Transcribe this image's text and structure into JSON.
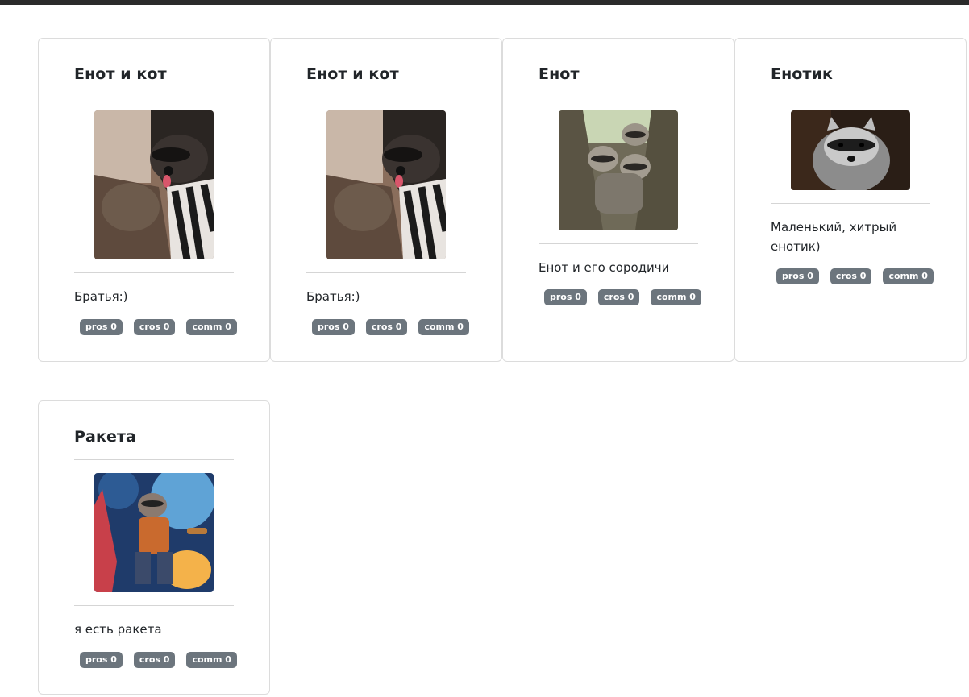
{
  "cards": [
    {
      "title": "Енот и кот",
      "description": "Братья:)",
      "image": "raccoon-and-cat-photo",
      "badges": {
        "pros": "pros 0",
        "cros": "cros 0",
        "comm": "comm 0"
      }
    },
    {
      "title": "Енот и кот",
      "description": "Братья:)",
      "image": "raccoon-and-cat-photo",
      "badges": {
        "pros": "pros 0",
        "cros": "cros 0",
        "comm": "comm 0"
      }
    },
    {
      "title": "Енот",
      "description": "Енот и его сородичи",
      "image": "three-raccoons-in-tree-photo",
      "badges": {
        "pros": "pros 0",
        "cros": "cros 0",
        "comm": "comm 0"
      }
    },
    {
      "title": "Енотик",
      "description": "Маленький, хитрый енотик)",
      "image": "raccoon-portrait-photo",
      "badges": {
        "pros": "pros 0",
        "cros": "cros 0",
        "comm": "comm 0"
      }
    },
    {
      "title": "Ракета",
      "description": "я есть ракета",
      "image": "rocket-raccoon-illustration",
      "badges": {
        "pros": "pros 0",
        "cros": "cros 0",
        "comm": "comm 0"
      }
    }
  ]
}
